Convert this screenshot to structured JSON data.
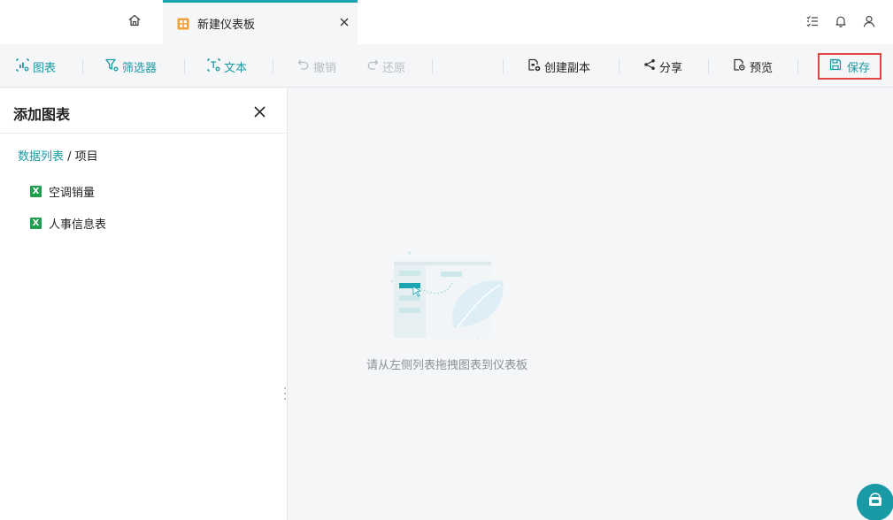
{
  "tabs": {
    "home_icon": "home-icon",
    "active_tab": {
      "icon": "dashboard-icon",
      "label": "新建仪表板",
      "close_icon": "close-icon"
    }
  },
  "top_actions": [
    "task-list-icon",
    "bell-icon",
    "user-icon"
  ],
  "toolbar": {
    "chart_label": "图表",
    "filter_label": "筛选器",
    "text_label": "文本",
    "undo_label": "撤销",
    "redo_label": "还原",
    "duplicate_label": "创建副本",
    "share_label": "分享",
    "preview_label": "预览",
    "save_label": "保存"
  },
  "panel": {
    "title": "添加图表",
    "breadcrumb": {
      "root": "数据列表",
      "separator": " / ",
      "current": "项目"
    },
    "files": [
      {
        "label": "空调销量",
        "icon": "excel-icon"
      },
      {
        "label": "人事信息表",
        "icon": "excel-icon"
      }
    ]
  },
  "canvas": {
    "empty_hint": "请从左侧列表拖拽图表到仪表板"
  },
  "colors": {
    "accent": "#1a9aa5",
    "highlight_border": "#e04444",
    "tab_icon": "#f2a23a",
    "excel": "#1f9e4f"
  }
}
